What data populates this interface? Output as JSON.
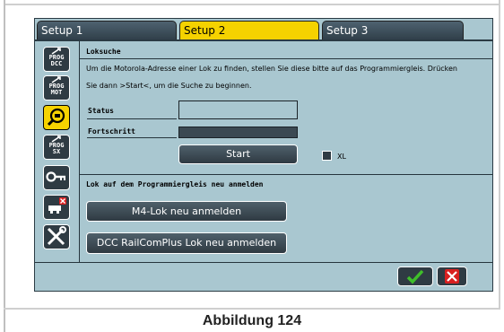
{
  "tabs": [
    {
      "label": "Setup 1",
      "active": false
    },
    {
      "label": "Setup 2",
      "active": true
    },
    {
      "label": "Setup 3",
      "active": false
    }
  ],
  "sidebar": {
    "items": [
      {
        "icon": "prog-dcc-icon",
        "label_line1": "PROG",
        "label_line2": "DCC"
      },
      {
        "icon": "prog-mot-icon",
        "label_line1": "PROG",
        "label_line2": "MOT"
      },
      {
        "icon": "loco-search-icon",
        "active": true
      },
      {
        "icon": "prog-sx-icon",
        "label_line1": "PROG",
        "label_line2": "SX"
      },
      {
        "icon": "key-icon"
      },
      {
        "icon": "delete-loco-icon"
      },
      {
        "icon": "tools-icon"
      }
    ]
  },
  "loksuche": {
    "title": "Loksuche",
    "description_line1": "Um die Motorola-Adresse einer Lok zu finden, stellen Sie diese bitte auf das Programmiergleis. Drücken",
    "description_line2": "Sie dann >Start<, um die Suche zu beginnen.",
    "status_label": "Status",
    "status_value": "",
    "progress_label": "Fortschritt",
    "progress_value": 0,
    "start_button": "Start",
    "xl_label": "XL",
    "xl_checked": false
  },
  "anmelden": {
    "title": "Lok auf dem Programmiergleis neu anmelden",
    "m4_button": "M4-Lok neu anmelden",
    "dcc_button": "DCC RailComPlus Lok neu anmelden"
  },
  "footer": {
    "ok_icon": "check-icon",
    "cancel_icon": "close-icon"
  },
  "caption": "Abbildung 124",
  "colors": {
    "accent": "#f5d200",
    "background": "#a9c7d0",
    "button": "#2f3b43",
    "ok": "#3fbf2a",
    "cancel": "#d82020",
    "arrow": "#f5c000"
  }
}
